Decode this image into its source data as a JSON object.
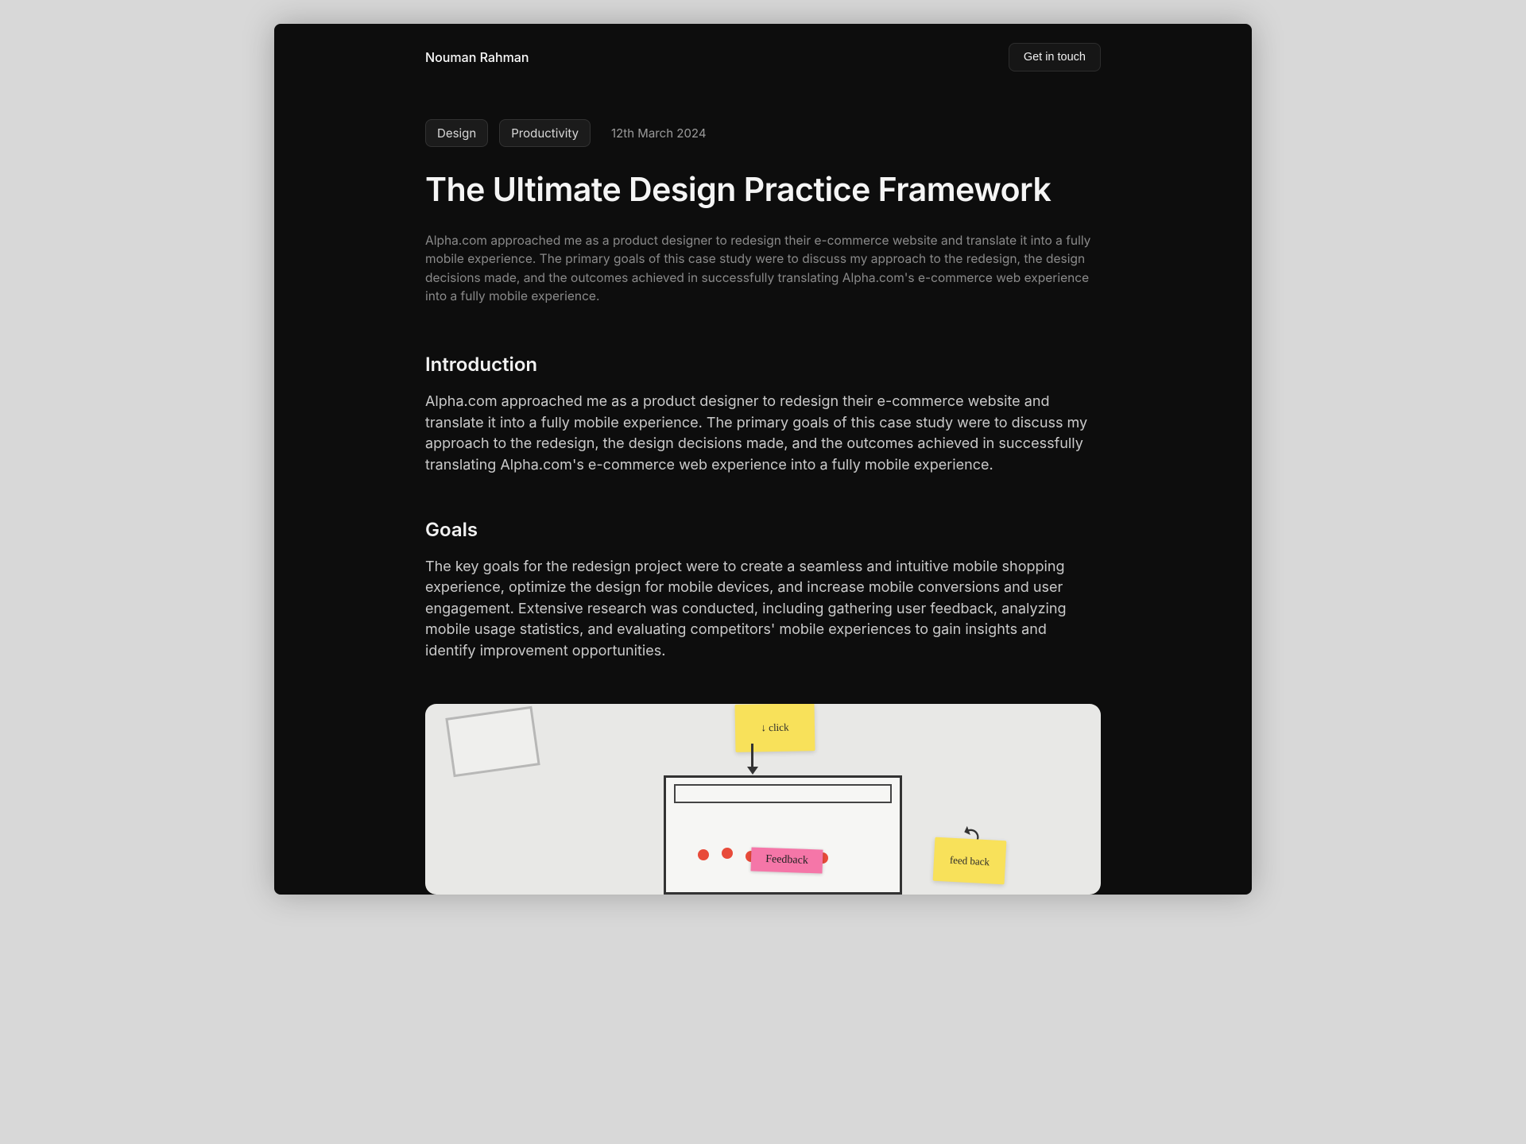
{
  "header": {
    "site_name": "Nouman Rahman",
    "cta_label": "Get in touch"
  },
  "post": {
    "tags": [
      "Design",
      "Productivity"
    ],
    "date": "12th March 2024",
    "title": "The Ultimate Design Practice Framework",
    "lead": "Alpha.com approached me as a product designer to redesign their e-commerce website and translate it into a fully mobile experience. The primary goals of this case study were to discuss my approach to the redesign, the design decisions made, and the outcomes achieved in successfully translating Alpha.com's e-commerce web experience into a fully mobile experience.",
    "sections": [
      {
        "heading": "Introduction",
        "body": "Alpha.com approached me as a product designer to redesign their e-commerce website and translate it into a fully mobile experience. The primary goals of this case study were to discuss my approach to the redesign, the design decisions made, and the outcomes achieved in successfully translating Alpha.com's e-commerce web experience into a fully mobile experience."
      },
      {
        "heading": "Goals",
        "body": "The key goals for the redesign project were to create a seamless and intuitive mobile shopping experience, optimize the design for mobile devices, and increase mobile conversions and user engagement. Extensive research was conducted, including gathering user feedback, analyzing mobile usage statistics, and evaluating competitors' mobile experiences to gain insights and identify improvement opportunities."
      }
    ],
    "image_notes": {
      "sticky1": "↓ click",
      "sticky2": "feed back",
      "sticky_pink": "Feedback"
    }
  }
}
